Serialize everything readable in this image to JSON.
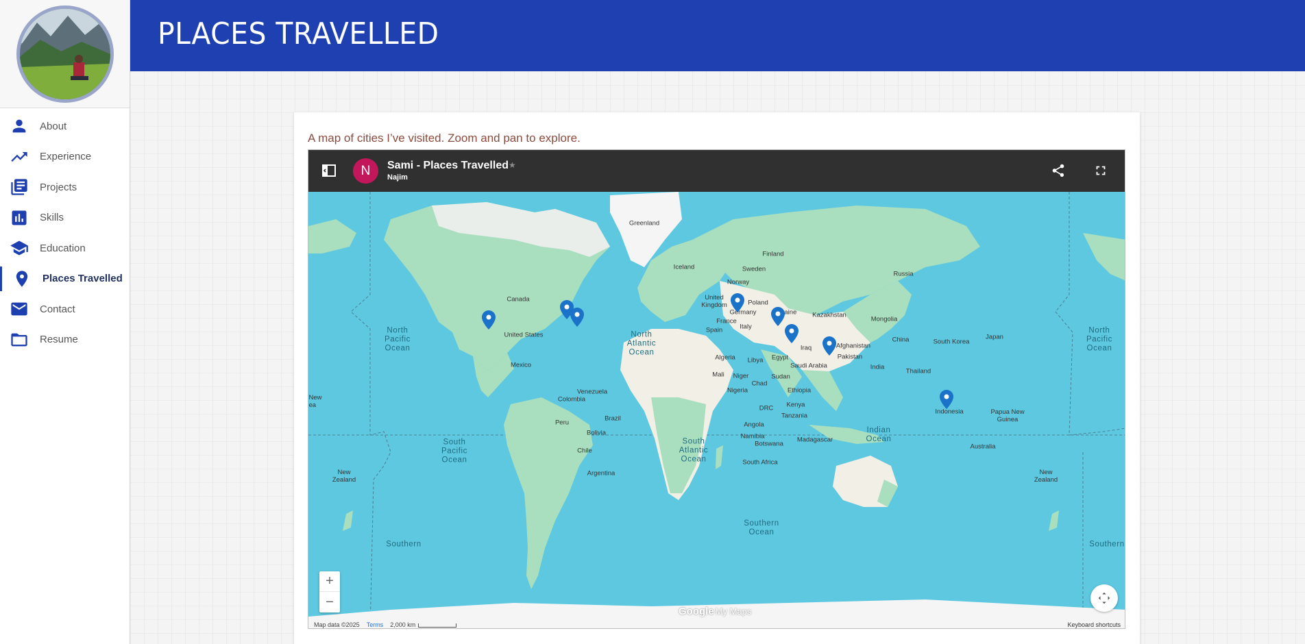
{
  "header": {
    "title": "PLACES TRAVELLED"
  },
  "sidebar": {
    "items": [
      {
        "label": "About",
        "icon": "person-icon"
      },
      {
        "label": "Experience",
        "icon": "trending-up-icon"
      },
      {
        "label": "Projects",
        "icon": "library-books-icon"
      },
      {
        "label": "Skills",
        "icon": "bar-chart-icon"
      },
      {
        "label": "Education",
        "icon": "school-icon"
      },
      {
        "label": "Places Travelled",
        "icon": "location-pin-icon",
        "active": true
      },
      {
        "label": "Contact",
        "icon": "mail-icon"
      },
      {
        "label": "Resume",
        "icon": "folder-icon"
      }
    ]
  },
  "main": {
    "caption": "A map of cities I’ve visited. Zoom and pan to explore."
  },
  "map": {
    "owner_initial": "N",
    "title": "Sami - Places Travelled",
    "owner": "Najim",
    "star": "★",
    "zoom_in": "+",
    "zoom_out": "−",
    "logo": "Google",
    "logo_suffix": "My Maps",
    "attribution": "Map data ©2025",
    "terms": "Terms",
    "scale": "2,000 km",
    "keyboard": "Keyboard shortcuts",
    "colors": {
      "water": "#5dc8e0",
      "land": "#a9dfbf",
      "desert": "#f1efe6",
      "ice": "#f5f5f5",
      "pin": "#1a73c9"
    },
    "labels": {
      "greenland": "Greenland",
      "iceland": "Iceland",
      "finland": "Finland",
      "sweden": "Sweden",
      "norway": "Norway",
      "russia": "Russia",
      "uk": "United\nKingdom",
      "poland": "Poland",
      "ukraine": "Ukraine",
      "germany": "Germany",
      "kazakhstan": "Kazakhstan",
      "mongolia": "Mongolia",
      "france": "France",
      "italy": "Italy",
      "spain": "Spain",
      "canada": "Canada",
      "us": "United States",
      "mexico": "Mexico",
      "iraq": "Iraq",
      "afghanistan": "Afghanistan",
      "pakistan": "Pakistan",
      "china": "China",
      "south_korea": "South Korea",
      "japan": "Japan",
      "india": "India",
      "algeria": "Algeria",
      "libya": "Libya",
      "egypt": "Egypt",
      "saudi": "Saudi Arabia",
      "thailand": "Thailand",
      "mali": "Mali",
      "niger": "Niger",
      "chad": "Chad",
      "sudan": "Sudan",
      "nigeria": "Nigeria",
      "ethiopia": "Ethiopia",
      "venezuela": "Venezuela",
      "colombia": "Colombia",
      "kenya": "Kenya",
      "drc": "DRC",
      "tanzania": "Tanzania",
      "indonesia": "Indonesia",
      "png": "Papua New\nGuinea",
      "peru": "Peru",
      "brazil": "Brazil",
      "bolivia": "Bolivia",
      "angola": "Angola",
      "namibia": "Namibia",
      "botswana": "Botswana",
      "madagascar": "Madagascar",
      "australia": "Australia",
      "chile": "Chile",
      "south_africa": "South Africa",
      "argentina": "Argentina",
      "new_zealand_w": "New\nZealand",
      "new_zealand_e": "New\nZealand",
      "new_left": "New\nea",
      "npo_w": "North\nPacific\nOcean",
      "npo_e": "North\nPacific\nOcean",
      "nao": "North\nAtlantic\nOcean",
      "spo": "South\nPacific\nOcean",
      "sao": "South\nAtlantic\nOcean",
      "io": "Indian\nOcean",
      "so": "Southern\nOcean",
      "so_left": "Southern",
      "so_right": "Southern"
    }
  }
}
